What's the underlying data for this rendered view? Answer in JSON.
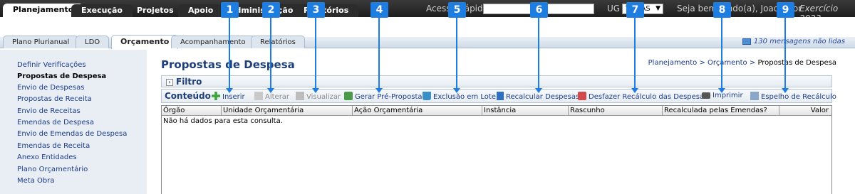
{
  "topnav": {
    "tabs": [
      "Planejamento",
      "Execução",
      "Projetos",
      "Apoio",
      "Administração",
      "Relatórios"
    ],
    "quick_access_label": "Acesso Rápido",
    "quick_access_value": "",
    "ug_label": "UG",
    "ug_selected": "TODAS",
    "welcome": "Seja bem-vindo(a), Joao Vitor",
    "exercise": "Exercício 2023"
  },
  "subnav": {
    "tabs": [
      "Plano Plurianual",
      "LDO",
      "Orçamento",
      "Acompanhamento",
      "Relatórios"
    ],
    "messages": "130 mensagens não lidas"
  },
  "sidebar": {
    "items": [
      "Definir Verificações",
      "Propostas de Despesa",
      "Envio de Despesas",
      "Propostas de Receita",
      "Envio de Receitas",
      "Emendas de Despesa",
      "Envio de Emendas de Despesa",
      "Emendas de Receita",
      "Anexo Entidades",
      "Plano Orçamentário",
      "Meta Obra"
    ]
  },
  "main": {
    "title": "Propostas de Despesa",
    "breadcrumb": [
      "Planejamento",
      "Orçamento",
      "Propostas de Despesa"
    ],
    "filter_label": "Filtro",
    "content_label": "Conteúdo",
    "toolbar": [
      {
        "label": "Inserir",
        "icon": "plus-icon",
        "enabled": true
      },
      {
        "label": "Alterar",
        "icon": "edit-icon",
        "enabled": false
      },
      {
        "label": "Visualizar",
        "icon": "view-icon",
        "enabled": false
      },
      {
        "label": "Gerar Pré-Proposta",
        "icon": "generate-icon",
        "enabled": true
      },
      {
        "label": "Exclusão em Lote",
        "icon": "batch-delete-icon",
        "enabled": true
      },
      {
        "label": "Recalcular Despesas",
        "icon": "calculator-icon",
        "enabled": true
      },
      {
        "label": "Desfazer Recálculo das Despesas",
        "icon": "undo-recalc-icon",
        "enabled": true
      },
      {
        "label": "Imprimir",
        "icon": "printer-icon",
        "enabled": true
      },
      {
        "label": "Espelho de Recálculo",
        "icon": "report-icon",
        "enabled": true
      }
    ],
    "columns": [
      "Órgão",
      "Unidade Orçamentária",
      "Ação Orçamentária",
      "Instância",
      "Rascunho",
      "Recalculada pelas Emendas?",
      "Valor"
    ],
    "empty_message": "Não há dados para esta consulta."
  },
  "callouts": [
    "1",
    "2",
    "3",
    "4",
    "5",
    "6",
    "7",
    "8",
    "9"
  ],
  "colors": {
    "callout": "#1e7de0",
    "topbar": "#2a2a2a",
    "link": "#1a3c8a"
  }
}
